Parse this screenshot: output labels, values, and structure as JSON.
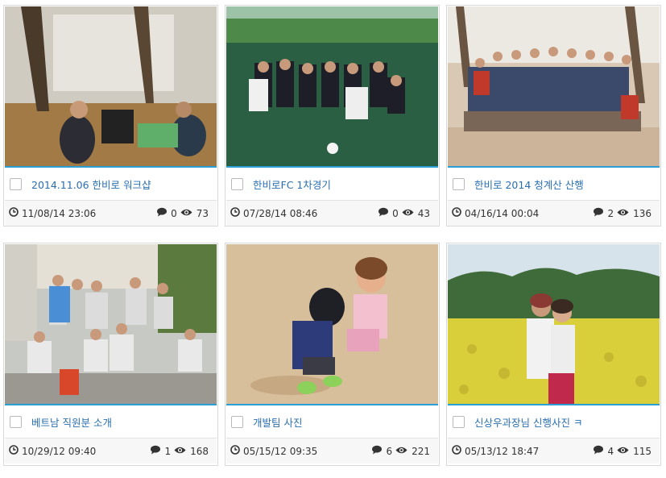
{
  "cards": [
    {
      "title": "2014.11.06 한비로 워크샵",
      "date": "11/08/14 23:06",
      "comments": "0",
      "views": "73"
    },
    {
      "title": "한비로FC 1차경기",
      "date": "07/28/14 08:46",
      "comments": "0",
      "views": "43"
    },
    {
      "title": "한비로 2014 청계산 산행",
      "date": "04/16/14 00:04",
      "comments": "2",
      "views": "136"
    },
    {
      "title": "베트남 직원분 소개",
      "date": "10/29/12 09:40",
      "comments": "1",
      "views": "168"
    },
    {
      "title": "개발팀 사진",
      "date": "05/15/12 09:35",
      "comments": "6",
      "views": "221"
    },
    {
      "title": "신상우과장님 신행사진 ㅋ",
      "date": "05/13/12 18:47",
      "comments": "4",
      "views": "115"
    }
  ],
  "icons": {
    "clock": "clock-icon",
    "comment": "comment-icon",
    "views": "eye-icon"
  },
  "colors": {
    "accent": "#2a9fd6",
    "title": "#2a6fb0"
  }
}
